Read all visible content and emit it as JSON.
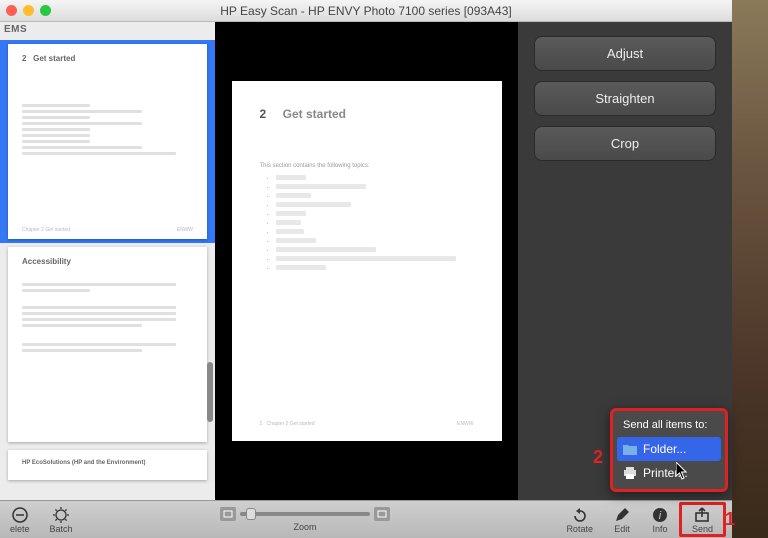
{
  "window": {
    "title": "HP Easy Scan - HP ENVY Photo 7100 series [093A43]"
  },
  "sidebar": {
    "header_partial": "EMS"
  },
  "thumbs": [
    {
      "num": "2",
      "title": "Get started",
      "footer_left": "Chapter 2   Get started",
      "footer_right": "ENWW"
    },
    {
      "title": "Accessibility"
    },
    {
      "title": "HP EcoSolutions (HP and the Environment)"
    }
  ],
  "page": {
    "num": "2",
    "title": "Get started",
    "subtitle": "This section contains the following topics:",
    "footer_left": "Chapter 2   Get started",
    "footer_right": "ENWW",
    "footer_page": "2"
  },
  "rightpanel": {
    "buttons": {
      "adjust": "Adjust",
      "straighten": "Straighten",
      "crop": "Crop"
    }
  },
  "popup": {
    "title": "Send all items to:",
    "items": {
      "folder": "Folder...",
      "printer": "Printer..."
    }
  },
  "toolbar": {
    "delete": "elete",
    "batch": "Batch",
    "zoom": "Zoom",
    "rotate": "Rotate",
    "edit": "Edit",
    "info": "Info",
    "send": "Send"
  },
  "annotations": {
    "one": "1",
    "two": "2"
  }
}
